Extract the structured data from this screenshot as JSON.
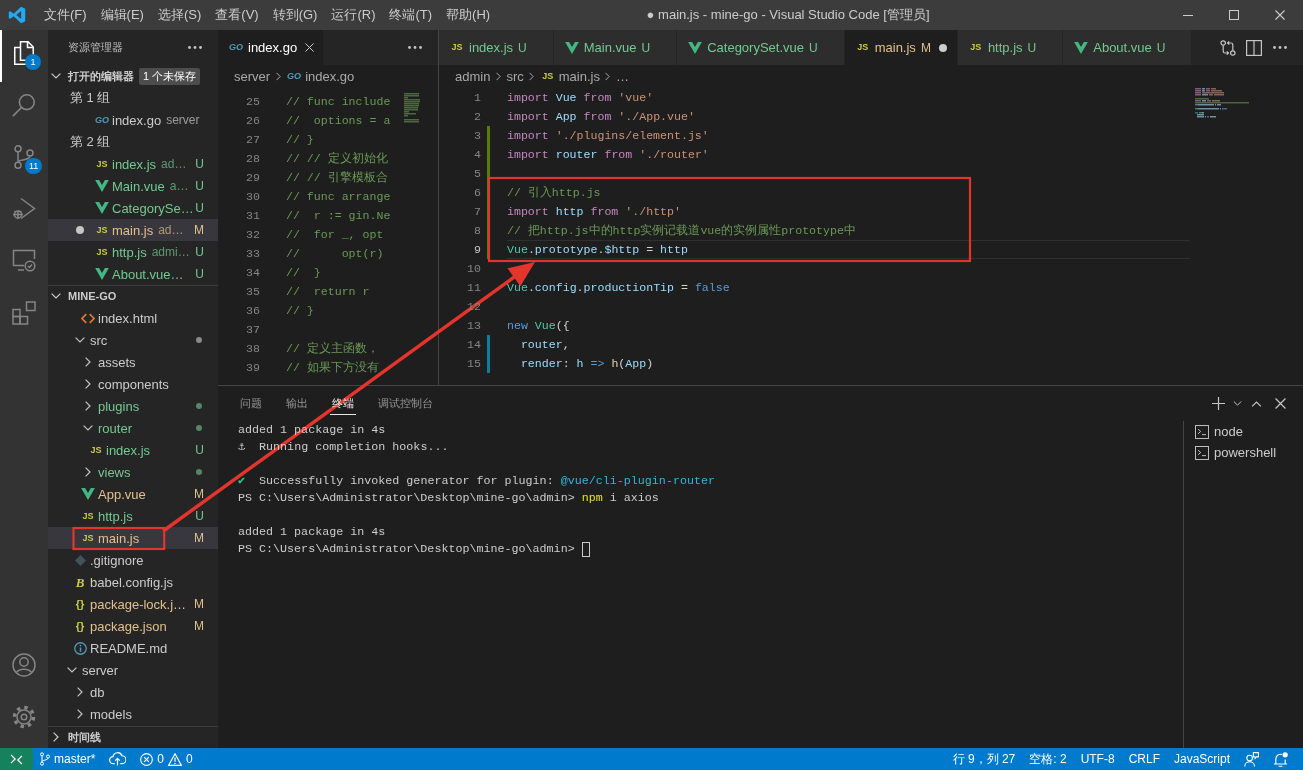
{
  "title_bar": {
    "menu": [
      "文件(F)",
      "编辑(E)",
      "选择(S)",
      "查看(V)",
      "转到(G)",
      "运行(R)",
      "终端(T)",
      "帮助(H)"
    ],
    "title": "● main.js - mine-go - Visual Studio Code [管理员]"
  },
  "activity_bar": {
    "items": [
      {
        "kind": "explorer",
        "selected": true,
        "badge": "1"
      },
      {
        "kind": "search",
        "selected": false
      },
      {
        "kind": "source-control",
        "selected": false,
        "badge": "11"
      },
      {
        "kind": "run-debug",
        "selected": false
      },
      {
        "kind": "remote-explorer",
        "selected": false
      },
      {
        "kind": "extensions",
        "selected": false
      }
    ],
    "bottom_items": [
      {
        "kind": "account"
      },
      {
        "kind": "settings"
      }
    ]
  },
  "sidebar": {
    "title": "资源管理器",
    "open_editors": {
      "title": "打开的编辑器",
      "expanded": true,
      "badge": "1 个未保存",
      "groups": [
        {
          "label": "第 1 组",
          "files": [
            {
              "name": "index.go",
              "detail": "server",
              "kind": "go",
              "glyph": "GO",
              "color": "#cccccc",
              "dirty": false,
              "selected": false
            }
          ]
        },
        {
          "label": "第 2 组",
          "files": [
            {
              "name": "index.js",
              "detail": "ad…",
              "kind": "js",
              "glyph": "JS",
              "color": "#73c991",
              "status": "U",
              "dirty": false,
              "selected": false
            },
            {
              "name": "Main.vue",
              "detail": "a…",
              "kind": "vue",
              "color": "#73c991",
              "status": "U",
              "dirty": false,
              "selected": false
            },
            {
              "name": "CategorySe…",
              "kind": "vue",
              "color": "#73c991",
              "status": "U",
              "dirty": false,
              "selected": false
            },
            {
              "name": "main.js",
              "detail": "ad…",
              "kind": "js",
              "glyph": "JS",
              "color": "#e2c08d",
              "status": "M",
              "dirty": true,
              "selected": true
            },
            {
              "name": "http.js",
              "detail": "admi…",
              "kind": "js",
              "glyph": "JS",
              "color": "#73c991",
              "status": "U",
              "dirty": false,
              "selected": false
            },
            {
              "name": "About.vue…",
              "kind": "vue",
              "color": "#73c991",
              "status": "U",
              "dirty": false,
              "selected": false
            }
          ]
        }
      ]
    },
    "folder": {
      "title": "MINE-GO",
      "expanded": true,
      "items": [
        {
          "kind": "offscreen-folder",
          "children": [
            {
              "kind": "offscreen-folder",
              "children": [
                {
                  "kind": "html",
                  "name": "index.html",
                  "color": "#cccccc",
                  "selected": false,
                  "highlighted": false
                }
              ]
            },
            {
              "kind": "folder",
              "name": "src",
              "expanded": true,
              "dot": true,
              "color": "#cccccc",
              "selected": false,
              "highlighted": false,
              "children": [
                {
                  "kind": "folder",
                  "name": "assets",
                  "expanded": false,
                  "dot": false,
                  "color": "#cccccc",
                  "selected": false,
                  "highlighted": false
                },
                {
                  "kind": "folder",
                  "name": "components",
                  "expanded": false,
                  "dot": false,
                  "color": "#cccccc",
                  "selected": false,
                  "highlighted": false
                },
                {
                  "kind": "folder",
                  "name": "plugins",
                  "expanded": false,
                  "dot": true,
                  "color": "#73c991",
                  "selected": false,
                  "highlighted": false
                },
                {
                  "kind": "folder",
                  "name": "router",
                  "expanded": true,
                  "dot": true,
                  "color": "#73c991",
                  "selected": false,
                  "highlighted": false,
                  "children": [
                    {
                      "kind": "js",
                      "name": "index.js",
                      "glyph": "JS",
                      "color": "#73c991",
                      "status": "U",
                      "selected": false,
                      "highlighted": false
                    }
                  ]
                },
                {
                  "kind": "folder",
                  "name": "views",
                  "expanded": false,
                  "dot": true,
                  "color": "#73c991",
                  "selected": false,
                  "highlighted": false
                },
                {
                  "kind": "vue",
                  "name": "App.vue",
                  "color": "#e2c08d",
                  "status": "M",
                  "selected": false,
                  "highlighted": false
                },
                {
                  "kind": "js",
                  "name": "http.js",
                  "glyph": "JS",
                  "color": "#73c991",
                  "status": "U",
                  "selected": false,
                  "highlighted": false
                },
                {
                  "kind": "js",
                  "name": "main.js",
                  "glyph": "JS",
                  "color": "#e2c08d",
                  "status": "M",
                  "selected": true,
                  "highlighted": true
                }
              ]
            },
            {
              "kind": "gitignore",
              "name": ".gitignore",
              "color": "#cccccc",
              "selected": false,
              "highlighted": false
            },
            {
              "kind": "babel",
              "name": "babel.config.js",
              "glyph": "B",
              "color": "#cccccc",
              "selected": false,
              "highlighted": false
            },
            {
              "kind": "json",
              "name": "package-lock.j…",
              "glyph": "{}",
              "color": "#e2c08d",
              "status": "M",
              "selected": false,
              "highlighted": false
            },
            {
              "kind": "json",
              "name": "package.json",
              "glyph": "{}",
              "color": "#e2c08d",
              "status": "M",
              "selected": false,
              "highlighted": false
            },
            {
              "kind": "markdown",
              "name": "README.md",
              "color": "#cccccc",
              "selected": false,
              "highlighted": false
            }
          ]
        },
        {
          "kind": "folder",
          "name": "server",
          "expanded": true,
          "dot": false,
          "color": "#cccccc",
          "selected": false,
          "highlighted": false,
          "children": [
            {
              "kind": "folder",
              "name": "db",
              "expanded": false,
              "dot": false,
              "color": "#cccccc",
              "selected": false,
              "highlighted": false
            },
            {
              "kind": "folder",
              "name": "models",
              "expanded": false,
              "dot": false,
              "color": "#cccccc",
              "selected": false,
              "highlighted": false
            }
          ]
        }
      ]
    },
    "timeline": {
      "title": "时间线",
      "expanded": false
    }
  },
  "editor_groups": [
    {
      "tabs": [
        {
          "name": "index.go",
          "kind": "go",
          "glyph": "GO",
          "color": "#ffffff",
          "selected": true,
          "dirty": false
        }
      ],
      "actions": [
        {
          "kind": "more"
        }
      ],
      "breadcrumbs": [
        {
          "label": "server"
        },
        {
          "label": "index.go",
          "kind": "go",
          "glyph": "GO"
        }
      ],
      "lines": [
        {
          "number": "25",
          "tokens": [
            {
              "kind": "comment",
              "text": "// func include"
            }
          ]
        },
        {
          "number": "26",
          "tokens": [
            {
              "kind": "comment",
              "text": "//  options = a"
            }
          ]
        },
        {
          "number": "27",
          "tokens": [
            {
              "kind": "comment",
              "text": "// }"
            }
          ]
        },
        {
          "number": "28",
          "tokens": [
            {
              "kind": "comment",
              "text": "// // 定义初始化"
            }
          ]
        },
        {
          "number": "29",
          "tokens": [
            {
              "kind": "comment",
              "text": "// // 引擎模板合"
            }
          ]
        },
        {
          "number": "30",
          "tokens": [
            {
              "kind": "comment",
              "text": "// func arrange"
            }
          ]
        },
        {
          "number": "31",
          "tokens": [
            {
              "kind": "comment",
              "text": "//  r := gin.Ne"
            }
          ]
        },
        {
          "number": "32",
          "tokens": [
            {
              "kind": "comment",
              "text": "//  for _, opt"
            }
          ]
        },
        {
          "number": "33",
          "tokens": [
            {
              "kind": "comment",
              "text": "//      opt(r)"
            }
          ]
        },
        {
          "number": "34",
          "tokens": [
            {
              "kind": "comment",
              "text": "//  }"
            }
          ]
        },
        {
          "number": "35",
          "tokens": [
            {
              "kind": "comment",
              "text": "//  return r"
            }
          ]
        },
        {
          "number": "36",
          "tokens": [
            {
              "kind": "comment",
              "text": "// }"
            }
          ]
        },
        {
          "number": "37"
        },
        {
          "number": "38",
          "tokens": [
            {
              "kind": "comment",
              "text": "// 定义主函数，"
            }
          ]
        },
        {
          "number": "39",
          "tokens": [
            {
              "kind": "comment",
              "text": "// 如果下方没有"
            }
          ]
        }
      ]
    },
    {
      "tabs": [
        {
          "name": "index.js",
          "kind": "js",
          "glyph": "JS",
          "color": "#73c991",
          "status": "U",
          "selected": false,
          "dirty": false
        },
        {
          "name": "Main.vue",
          "kind": "vue",
          "color": "#73c991",
          "status": "U",
          "selected": false,
          "dirty": false
        },
        {
          "name": "CategorySet.vue",
          "kind": "vue",
          "color": "#73c991",
          "status": "U",
          "selected": false,
          "dirty": false
        },
        {
          "name": "main.js",
          "kind": "js",
          "glyph": "JS",
          "color": "#e2c08d",
          "status": "M",
          "selected": true,
          "dirty": true
        },
        {
          "name": "http.js",
          "kind": "js",
          "glyph": "JS",
          "color": "#73c991",
          "status": "U",
          "selected": false,
          "dirty": false
        },
        {
          "name": "About.vue",
          "kind": "vue",
          "color": "#73c991",
          "status": "U",
          "selected": false,
          "dirty": false
        }
      ],
      "actions": [
        {
          "kind": "compare-changes"
        },
        {
          "kind": "split-editor"
        },
        {
          "kind": "more"
        }
      ],
      "breadcrumbs": [
        {
          "label": "admin"
        },
        {
          "label": "src"
        },
        {
          "label": "main.js",
          "kind": "js",
          "glyph": "JS"
        },
        {
          "label": "…"
        }
      ],
      "lines": [
        {
          "number": "1",
          "current": false,
          "highlighted": false,
          "tokens": [
            {
              "kind": "keyword",
              "text": "import"
            },
            {
              "kind": "variable",
              "text": " Vue "
            },
            {
              "kind": "keyword",
              "text": "from"
            },
            {
              "kind": "string",
              "text": " 'vue'"
            }
          ]
        },
        {
          "number": "2",
          "current": false,
          "highlighted": false,
          "tokens": [
            {
              "kind": "keyword",
              "text": "import"
            },
            {
              "kind": "variable",
              "text": " App "
            },
            {
              "kind": "keyword",
              "text": "from"
            },
            {
              "kind": "string",
              "text": " './App.vue'"
            }
          ]
        },
        {
          "number": "3",
          "color": "#587c0c",
          "current": false,
          "highlighted": false,
          "tokens": [
            {
              "kind": "keyword",
              "text": "import"
            },
            {
              "kind": "string",
              "text": " './plugins/element.js'"
            }
          ]
        },
        {
          "number": "4",
          "color": "#587c0c",
          "current": false,
          "highlighted": false,
          "tokens": [
            {
              "kind": "keyword",
              "text": "import"
            },
            {
              "kind": "variable",
              "text": " router "
            },
            {
              "kind": "keyword",
              "text": "from"
            },
            {
              "kind": "string",
              "text": " './router'"
            }
          ]
        },
        {
          "number": "5",
          "color": "#587c0c",
          "current": false,
          "highlighted": false
        },
        {
          "number": "6",
          "color": "#587c0c",
          "current": false,
          "highlighted": true,
          "tokens": [
            {
              "kind": "comment",
              "text": "// 引入http.js"
            }
          ]
        },
        {
          "number": "7",
          "color": "#587c0c",
          "current": false,
          "highlighted": true,
          "tokens": [
            {
              "kind": "keyword",
              "text": "import"
            },
            {
              "kind": "variable",
              "text": " http "
            },
            {
              "kind": "keyword",
              "text": "from"
            },
            {
              "kind": "string",
              "text": " './http'"
            }
          ]
        },
        {
          "number": "8",
          "color": "#587c0c",
          "current": false,
          "highlighted": true,
          "tokens": [
            {
              "kind": "comment",
              "text": "// 把http.js中的http实例记载道vue的实例属性prototype中"
            }
          ]
        },
        {
          "number": "9",
          "color": "#587c0c",
          "current": true,
          "highlighted": true,
          "tokens": [
            {
              "kind": "class",
              "text": "Vue"
            },
            {
              "kind": "plain",
              "text": "."
            },
            {
              "kind": "variable",
              "text": "prototype"
            },
            {
              "kind": "plain",
              "text": "."
            },
            {
              "kind": "variable",
              "text": "$http"
            },
            {
              "kind": "plain",
              "text": " = "
            },
            {
              "kind": "variable",
              "text": "http"
            }
          ]
        },
        {
          "number": "10",
          "current": false,
          "highlighted": false
        },
        {
          "number": "11",
          "current": false,
          "highlighted": false,
          "tokens": [
            {
              "kind": "class",
              "text": "Vue"
            },
            {
              "kind": "plain",
              "text": "."
            },
            {
              "kind": "variable",
              "text": "config"
            },
            {
              "kind": "plain",
              "text": "."
            },
            {
              "kind": "variable",
              "text": "productionTip"
            },
            {
              "kind": "plain",
              "text": " = "
            },
            {
              "kind": "constant",
              "text": "false"
            }
          ]
        },
        {
          "number": "12",
          "current": false,
          "highlighted": false
        },
        {
          "number": "13",
          "current": false,
          "highlighted": false,
          "tokens": [
            {
              "kind": "constant",
              "text": "new"
            },
            {
              "kind": "class",
              "text": " Vue"
            },
            {
              "kind": "plain",
              "text": "({"
            }
          ]
        },
        {
          "number": "14",
          "color": "#0c7d9d",
          "current": false,
          "highlighted": false,
          "tokens": [
            {
              "kind": "variable",
              "text": "  router"
            },
            {
              "kind": "plain",
              "text": ","
            }
          ]
        },
        {
          "number": "15",
          "color": "#0c7d9d",
          "current": false,
          "highlighted": false,
          "tokens": [
            {
              "kind": "variable",
              "text": "  render"
            },
            {
              "kind": "plain",
              "text": ": "
            },
            {
              "kind": "variable",
              "text": "h"
            },
            {
              "kind": "constant",
              "text": " =>"
            },
            {
              "kind": "function",
              "text": " h"
            },
            {
              "kind": "plain",
              "text": "("
            },
            {
              "kind": "variable",
              "text": "App"
            },
            {
              "kind": "plain",
              "text": ")"
            }
          ]
        }
      ]
    }
  ],
  "panel": {
    "tabs": [
      {
        "label": "问题",
        "selected": false
      },
      {
        "label": "输出",
        "selected": false
      },
      {
        "label": "终端",
        "selected": true
      },
      {
        "label": "调试控制台",
        "selected": false
      }
    ],
    "actions": [
      {
        "kind": "new-terminal"
      },
      {
        "kind": "terminal-dropdown"
      },
      {
        "kind": "maximize"
      },
      {
        "kind": "close"
      }
    ],
    "terminal": {
      "lines": [
        {
          "kind": "text",
          "cursor": false,
          "tokens": [
            {
              "kind": "output",
              "text": "added 1 package in 4s"
            }
          ]
        },
        {
          "kind": "text",
          "cursor": false,
          "tokens": [
            {
              "kind": "output",
              "text": "⚓  Running completion hooks..."
            }
          ]
        },
        {
          "kind": "blank"
        },
        {
          "kind": "text",
          "cursor": false,
          "tokens": [
            {
              "kind": "success",
              "text": "✔"
            },
            {
              "kind": "output",
              "text": "  Successfully invoked generator for plugin: "
            },
            {
              "kind": "link",
              "text": "@vue/cli-plugin-router"
            }
          ]
        },
        {
          "kind": "text",
          "cursor": false,
          "tokens": [
            {
              "kind": "output",
              "text": "PS C:\\Users\\Administrator\\Desktop\\mine-go\\admin> "
            },
            {
              "kind": "command",
              "text": "npm"
            },
            {
              "kind": "output",
              "text": " i axios"
            }
          ]
        },
        {
          "kind": "blank"
        },
        {
          "kind": "text",
          "cursor": false,
          "tokens": [
            {
              "kind": "output",
              "text": "added 1 package in 4s"
            }
          ]
        },
        {
          "kind": "text",
          "cursor": true,
          "tokens": [
            {
              "kind": "output",
              "text": "PS C:\\Users\\Administrator\\Desktop\\mine-go\\admin> "
            }
          ]
        }
      ]
    },
    "terminals": [
      {
        "label": "node"
      },
      {
        "label": "powershell"
      }
    ]
  },
  "status_bar": {
    "left": [
      {
        "kind": "remote"
      },
      {
        "kind": "branch",
        "label": "master*"
      },
      {
        "kind": "publish"
      },
      {
        "kind": "problems",
        "errors": "0",
        "warnings": "0"
      }
    ],
    "right": [
      {
        "kind": "cursor-position",
        "label": "行 9，列 27"
      },
      {
        "kind": "indentation",
        "label": "空格: 2"
      },
      {
        "kind": "encoding",
        "label": "UTF-8"
      },
      {
        "kind": "line-ending",
        "label": "CRLF"
      },
      {
        "kind": "language-mode",
        "label": "JavaScript"
      },
      {
        "kind": "feedback"
      },
      {
        "kind": "notifications"
      }
    ]
  },
  "annotations": [
    {
      "kind": "arrow"
    }
  ]
}
